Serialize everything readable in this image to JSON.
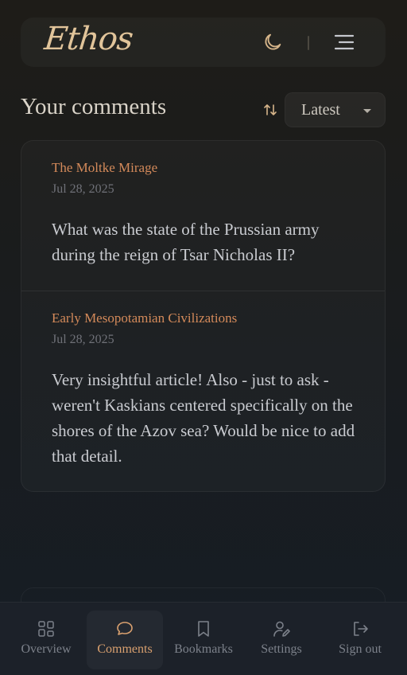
{
  "app": {
    "logo": "Ethos"
  },
  "header": {
    "theme_toggle_icon": "moon-icon",
    "menu_icon": "hamburger-menu-icon"
  },
  "page": {
    "title": "Your comments",
    "sort_icon": "sort-arrows-icon",
    "sort_value": "Latest"
  },
  "comments": [
    {
      "article": "The Moltke Mirage",
      "date": "Jul 28, 2025",
      "text": "What was the state of the Prussian army during the reign of Tsar Nicholas II?"
    },
    {
      "article": "Early Mesopotamian Civilizations",
      "date": "Jul 28, 2025",
      "text": "Very insightful article! Also - just to ask - weren't Kaskians centered specifically on the shores of the Azov sea? Would be nice to add that detail."
    }
  ],
  "nav": {
    "items": [
      {
        "label": "Overview",
        "icon": "grid-icon"
      },
      {
        "label": "Comments",
        "icon": "chat-bubble-icon",
        "active": true
      },
      {
        "label": "Bookmarks",
        "icon": "bookmark-icon"
      },
      {
        "label": "Settings",
        "icon": "user-settings-icon"
      },
      {
        "label": "Sign out",
        "icon": "sign-out-icon"
      }
    ]
  },
  "colors": {
    "accent": "#d48a5a",
    "logo": "#e1c49a",
    "active_nav": "#d9a06f"
  }
}
